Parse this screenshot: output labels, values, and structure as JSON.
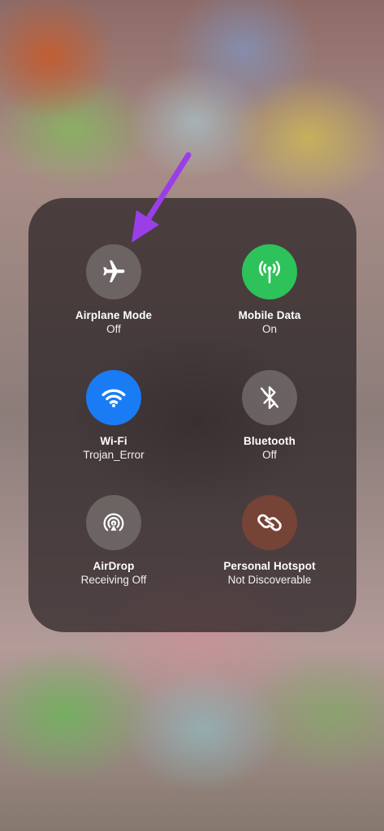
{
  "colors": {
    "mobile_data_on": "#2ec25a",
    "wifi_on": "#1a7cf5",
    "hotspot_tint": "#7b4436",
    "off_circle": "#7a7070",
    "arrow": "#9a3fe8"
  },
  "tiles": [
    {
      "label": "Airplane Mode",
      "status": "Off",
      "icon": "airplane-icon",
      "active": false
    },
    {
      "label": "Mobile Data",
      "status": "On",
      "icon": "antenna-icon",
      "active": true
    },
    {
      "label": "Wi-Fi",
      "status": "Trojan_Error",
      "icon": "wifi-icon",
      "active": true
    },
    {
      "label": "Bluetooth",
      "status": "Off",
      "icon": "bluetooth-off-icon",
      "active": false
    },
    {
      "label": "AirDrop",
      "status": "Receiving Off",
      "icon": "airdrop-icon",
      "active": false
    },
    {
      "label": "Personal Hotspot",
      "status": "Not Discoverable",
      "icon": "hotspot-icon",
      "active": false
    }
  ]
}
